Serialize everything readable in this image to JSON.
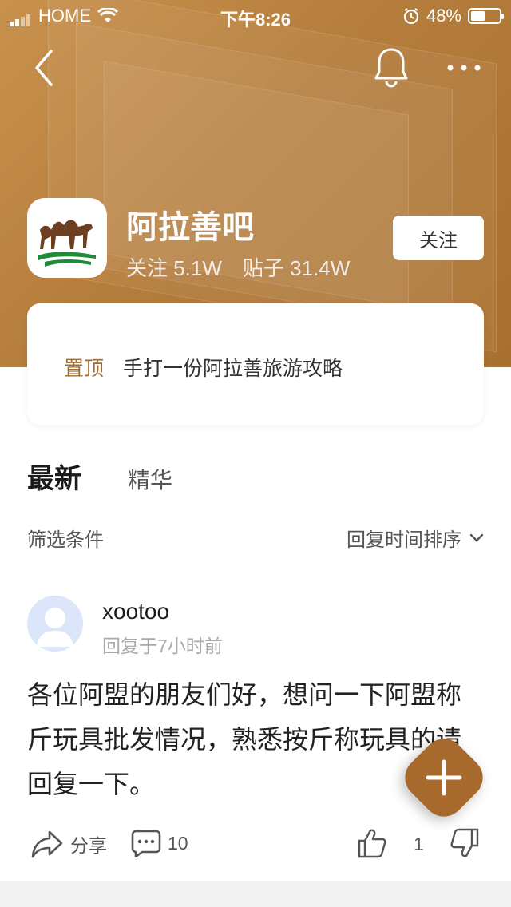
{
  "status_bar": {
    "carrier": "HOME",
    "time": "下午8:26",
    "battery": "48%"
  },
  "header": {
    "icons": [
      "back-icon",
      "bell-icon",
      "more-icon"
    ]
  },
  "forum": {
    "name": "阿拉善吧",
    "follow_label": "关注",
    "stats": {
      "followers": "关注 5.1W",
      "posts": "贴子 31.4W"
    }
  },
  "pinned": {
    "tag": "置顶",
    "title": "手打一份阿拉善旅游攻略"
  },
  "tabs": {
    "latest": "最新",
    "featured": "精华"
  },
  "filter": {
    "label": "筛选条件",
    "sort_label": "回复时间排序"
  },
  "post": {
    "author": "xootoo",
    "time": "回复于7小时前",
    "content": "各位阿盟的朋友们好，想问一下阿盟称斤玩具批发情况，熟悉按斤称玩具的请回复一下。",
    "share_label": "分享",
    "comment_count": "10",
    "like_count": "1"
  },
  "colors": {
    "brand": "#a86a2c",
    "hero_start": "#c8924d",
    "hero_end": "#a8702f"
  }
}
